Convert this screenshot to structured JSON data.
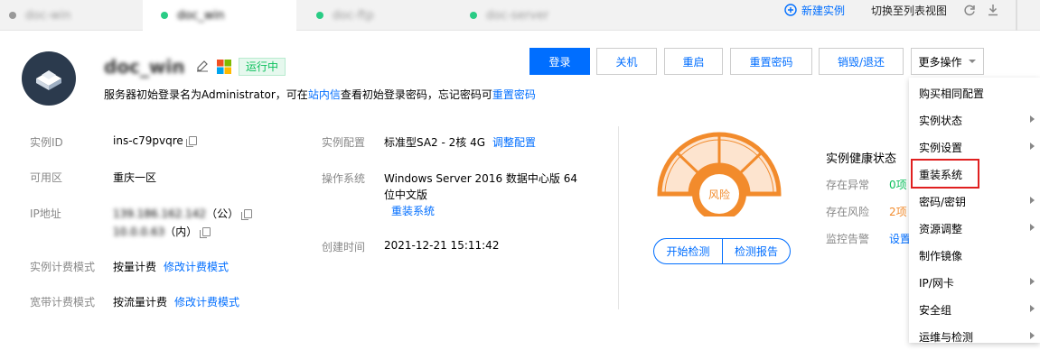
{
  "tabs": [
    {
      "name": "doc-win",
      "dot": "#999",
      "active": false
    },
    {
      "name": "doc_win",
      "dot": "#29cc85",
      "active": true
    },
    {
      "name": "doc-ftp",
      "dot": "#29cc85",
      "active": false
    },
    {
      "name": "doc-server",
      "dot": "#29cc85",
      "active": false
    }
  ],
  "toolbar": {
    "new_instance": "新建实例",
    "switch_view": "切换至列表视图"
  },
  "instance": {
    "name": "doc_win",
    "status": "运行中",
    "notice_prefix": "服务器初始登录名为Administrator，可在",
    "notice_link1": "站内信",
    "notice_mid": "查看初始登录密码，忘记密码可",
    "notice_link2": "重置密码"
  },
  "actions": {
    "login": "登录",
    "shutdown": "关机",
    "restart": "重启",
    "reset_pwd": "重置密码",
    "destroy": "销毁/退还",
    "more": "更多操作"
  },
  "details": {
    "id_label": "实例ID",
    "id_value": "ins-c79pvqre",
    "zone_label": "可用区",
    "zone_value": "重庆一区",
    "ip_label": "IP地址",
    "ip_public": "139.186.162.142",
    "ip_public_suffix": "（公）",
    "ip_private": "10.0.0.63",
    "ip_private_suffix": "（内）",
    "billing_label": "实例计费模式",
    "billing_value": "按量计费",
    "billing_link": "修改计费模式",
    "bw_label": "宽带计费模式",
    "bw_value": "按流量计费",
    "bw_link": "修改计费模式",
    "config_label": "实例配置",
    "config_value": "标准型SA2 - 2核 4G",
    "config_link": "调整配置",
    "os_label": "操作系统",
    "os_value1": "Windows Server 2016 数据中心版 64",
    "os_value2": "位中文版",
    "os_link": "重装系统",
    "created_label": "创建时间",
    "created_value": "2021-12-21 15:11:42"
  },
  "health": {
    "gauge_label": "风险",
    "start_check": "开始检测",
    "report": "检测报告",
    "title": "实例健康状态",
    "abnormal_label": "存在异常",
    "abnormal_value": "0项",
    "risk_label": "存在风险",
    "risk_value": "2项",
    "alarm_label": "监控告警",
    "alarm_value": "设置"
  },
  "menu": [
    {
      "label": "购买相同配置",
      "sub": false
    },
    {
      "label": "实例状态",
      "sub": true
    },
    {
      "label": "实例设置",
      "sub": true
    },
    {
      "label": "重装系统",
      "sub": false
    },
    {
      "label": "密码/密钥",
      "sub": true
    },
    {
      "label": "资源调整",
      "sub": true
    },
    {
      "label": "制作镜像",
      "sub": false
    },
    {
      "label": "IP/网卡",
      "sub": true
    },
    {
      "label": "安全组",
      "sub": true
    },
    {
      "label": "运维与检测",
      "sub": true
    }
  ],
  "colors": {
    "accent": "#006eff",
    "running": "#29cc85",
    "gauge": "#f28b2c",
    "highlight": "#e02020"
  }
}
